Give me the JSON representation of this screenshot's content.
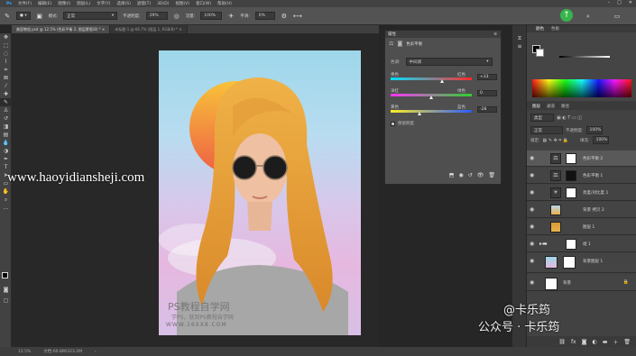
{
  "menubar": {
    "items": [
      "文件(F)",
      "编辑(E)",
      "图像(I)",
      "图层(L)",
      "文字(Y)",
      "选择(S)",
      "滤镜(T)",
      "3D(D)",
      "视图(V)",
      "窗口(W)",
      "帮助(H)"
    ]
  },
  "options": {
    "mode_label": "模式:",
    "mode_value": "正常",
    "opacity_label": "不透明度:",
    "opacity_value": "29%",
    "flow_label": "流量:",
    "flow_value": "100%",
    "smooth_label": "平滑:",
    "smooth_value": "0%"
  },
  "tabs": [
    {
      "label": "美容教程.psd @ 12.5% (色彩平衡 2, 图层蒙版/8) *"
    },
    {
      "label": "未标题-1 @ 66.7% (图层 1, RGB/8) *"
    }
  ],
  "properties": {
    "title": "属性",
    "subtitle": "色彩平衡",
    "tone_label": "色调:",
    "tone_value": "中间调",
    "sliders": [
      {
        "left": "青色",
        "right": "红色",
        "value": "+33",
        "pos": 0.63
      },
      {
        "left": "洋红",
        "right": "绿色",
        "value": "0",
        "pos": 0.5
      },
      {
        "left": "黄色",
        "right": "蓝色",
        "value": "-28",
        "pos": 0.36
      }
    ],
    "preserve_label": "保留明度"
  },
  "color_panel": {
    "tab1": "颜色",
    "tab2": "色板"
  },
  "layers_panel": {
    "tabs": [
      "图层",
      "通道",
      "路径"
    ],
    "kind": "类型",
    "blend": "正常",
    "opacity_label": "不透明度:",
    "opacity_value": "100%",
    "lock_label": "锁定:",
    "fill_label": "填充:",
    "fill_value": "100%",
    "layers": [
      {
        "name": "色彩平衡 2",
        "selected": true
      },
      {
        "name": "色彩平衡 1",
        "selected": false
      },
      {
        "name": "亮度/对比度 1",
        "selected": false
      },
      {
        "name": "背景 拷贝 2",
        "selected": false
      },
      {
        "name": "图层 1",
        "selected": false
      },
      {
        "name": "组 1",
        "selected": false
      },
      {
        "name": "背景图层 1",
        "selected": false
      },
      {
        "name": "背景",
        "selected": false
      }
    ]
  },
  "status": {
    "zoom": "12.5%",
    "doc": "文档:60.8M/323.2M"
  },
  "watermarks": {
    "site": "www.haoyidiansheji.com",
    "ps_title": "PS教程自学网",
    "ps_sub": "学PS，就到PS教程自学网",
    "ps_url": "WWW.16XX8.COM",
    "author": "@卡乐筠",
    "account": "公众号 · 卡乐筠"
  },
  "colors": {
    "accent": "#31a8ff",
    "sun_top": "#f7b536",
    "sun_bottom": "#ef6a3e",
    "hair": "#e9a23b",
    "green_btn": "#37b44a"
  }
}
